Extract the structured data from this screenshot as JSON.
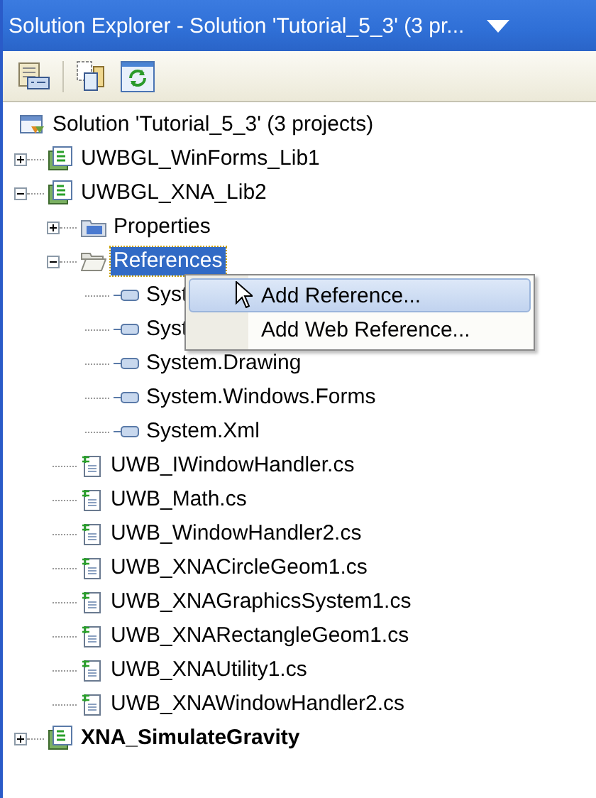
{
  "window": {
    "title": "Solution Explorer - Solution 'Tutorial_5_3' (3 pr..."
  },
  "toolbar": [
    {
      "kind": "properties"
    },
    {
      "kind": "show-all"
    },
    {
      "kind": "refresh"
    }
  ],
  "tree": [
    {
      "kind": "solution",
      "label": "Solution 'Tutorial_5_3' (3 projects)",
      "selected": false,
      "children": [
        {
          "kind": "project",
          "label": "UWBGL_WinForms_Lib1",
          "selected": false,
          "expanded": false,
          "startup": false
        },
        {
          "kind": "project",
          "label": "UWBGL_XNA_Lib2",
          "selected": false,
          "expanded": true,
          "startup": false,
          "children": [
            {
              "kind": "properties",
              "label": "Properties",
              "selected": false,
              "expanded": false
            },
            {
              "kind": "folder",
              "label": "References",
              "selected": true,
              "expanded": true,
              "children": [
                {
                  "kind": "reference",
                  "label": "Syst",
                  "selected": false
                },
                {
                  "kind": "reference",
                  "label": "Syst",
                  "selected": false
                },
                {
                  "kind": "reference",
                  "label": "System.Drawing",
                  "selected": false
                },
                {
                  "kind": "reference",
                  "label": "System.Windows.Forms",
                  "selected": false
                },
                {
                  "kind": "reference",
                  "label": "System.Xml",
                  "selected": false
                }
              ]
            },
            {
              "kind": "file",
              "label": "UWB_IWindowHandler.cs",
              "selected": false
            },
            {
              "kind": "file",
              "label": "UWB_Math.cs",
              "selected": false
            },
            {
              "kind": "file",
              "label": "UWB_WindowHandler2.cs",
              "selected": false
            },
            {
              "kind": "file",
              "label": "UWB_XNACircleGeom1.cs",
              "selected": false
            },
            {
              "kind": "file",
              "label": "UWB_XNAGraphicsSystem1.cs",
              "selected": false
            },
            {
              "kind": "file",
              "label": "UWB_XNARectangleGeom1.cs",
              "selected": false
            },
            {
              "kind": "file",
              "label": "UWB_XNAUtility1.cs",
              "selected": false
            },
            {
              "kind": "file",
              "label": "UWB_XNAWindowHandler2.cs",
              "selected": false
            }
          ]
        },
        {
          "kind": "project",
          "label": "XNA_SimulateGravity",
          "selected": false,
          "expanded": false,
          "startup": true
        }
      ]
    }
  ],
  "context_menu": {
    "items": [
      {
        "label": "Add Reference...",
        "selected": true
      },
      {
        "label": "Add Web Reference...",
        "selected": false
      }
    ]
  }
}
